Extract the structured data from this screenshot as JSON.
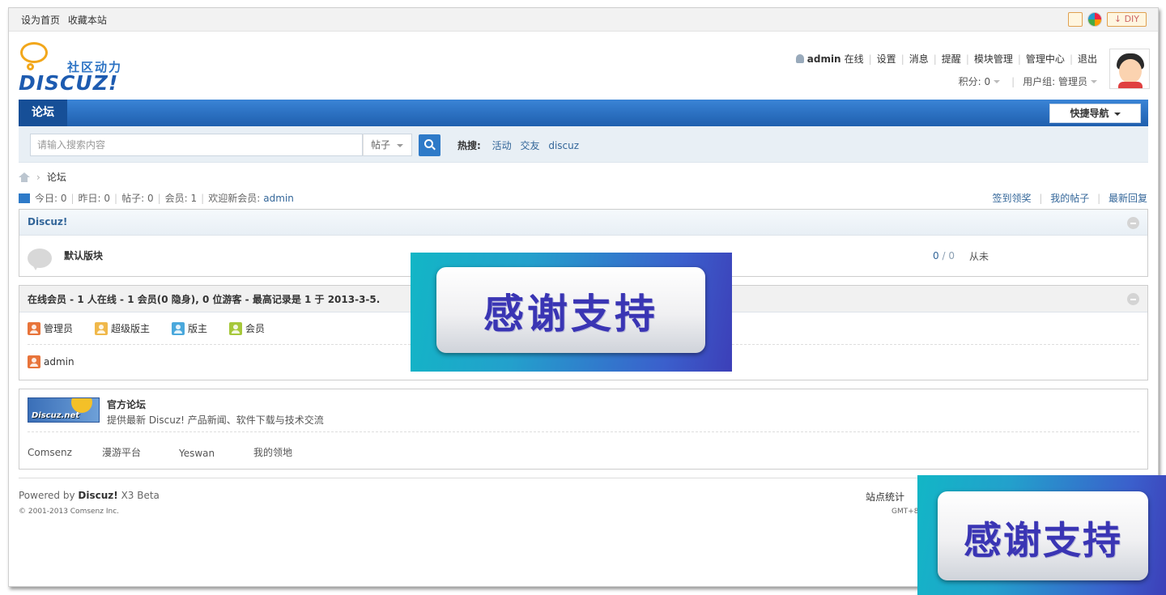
{
  "topbar": {
    "set_home": "设为首页",
    "bookmark": "收藏本站",
    "diy_label": "DIY"
  },
  "logo": {
    "cn": "社区动力",
    "brand": "DISCUZ!"
  },
  "user": {
    "name": "admin",
    "status": "在线",
    "links": [
      "设置",
      "消息",
      "提醒",
      "模块管理",
      "管理中心",
      "退出"
    ],
    "points": "积分: 0",
    "group": "用户组: 管理员"
  },
  "nav": {
    "forum_tab": "论坛",
    "quick_nav": "快捷导航"
  },
  "search": {
    "placeholder": "请输入搜索内容",
    "type": "帖子",
    "hot_label": "热搜:",
    "hot_terms": [
      "活动",
      "交友",
      "discuz"
    ]
  },
  "breadcrumb": {
    "current": "论坛"
  },
  "stats": {
    "today": "今日: 0",
    "yesterday": "昨日: 0",
    "posts": "帖子: 0",
    "members": "会员: 1",
    "welcome": "欢迎新会员:",
    "newest_member": "admin"
  },
  "right_links": [
    "签到领奖",
    "我的帖子",
    "最新回复"
  ],
  "forum_panel": {
    "title": "Discuz!",
    "forum_name": "默认版块",
    "count_a": "0",
    "count_sep": "/",
    "count_b": "0",
    "last_post": "从未"
  },
  "online_panel": {
    "title": "在线会员 - 1 人在线 - 1 会员(0 隐身), 0 位游客 - 最高记录是 1 于 2013-3-5.",
    "roles": [
      {
        "label": "管理员",
        "color": "#e8743a"
      },
      {
        "label": "超级版主",
        "color": "#f0b84a"
      },
      {
        "label": "版主",
        "color": "#4aa8dc"
      },
      {
        "label": "会员",
        "color": "#a6c83a"
      }
    ],
    "member": "admin"
  },
  "partner_panel": {
    "logo_text": "Discuz.net",
    "title": "官方论坛",
    "desc": "提供最新 Discuz! 产品新闻、软件下载与技术交流",
    "links": [
      "Comsenz",
      "漫游平台",
      "Yeswan",
      "我的领地"
    ]
  },
  "footer": {
    "powered_prefix": "Powered by",
    "powered_brand": "Discuz!",
    "powered_version": "X3 Beta",
    "copyright": "© 2001-2013 Comsenz Inc.",
    "stats_link": "站点统计",
    "gmt": "GMT+8"
  },
  "banner": {
    "text": "感谢支持"
  },
  "colors": {
    "nav_blue": "#1f5fae",
    "link": "#336699",
    "banner_text": "#3a35b4"
  }
}
